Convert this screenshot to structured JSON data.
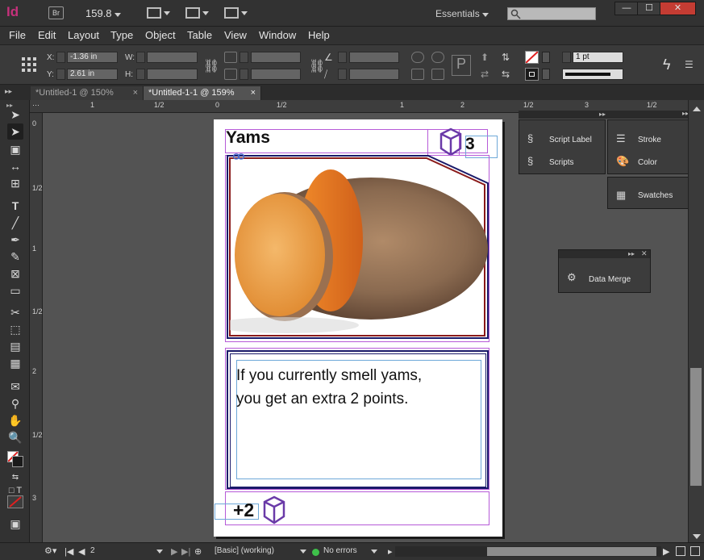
{
  "app": {
    "logo": "Id",
    "bridge_label": "Br",
    "zoom": "159.8",
    "workspace": "Essentials"
  },
  "window_controls": {
    "minimize": "—",
    "restore": "☐",
    "close": "✕"
  },
  "menu": [
    "File",
    "Edit",
    "Layout",
    "Type",
    "Object",
    "Table",
    "View",
    "Window",
    "Help"
  ],
  "control": {
    "x_label": "X:",
    "x_value": "-1.36 in",
    "y_label": "Y:",
    "y_value": "2.61 in",
    "w_label": "W:",
    "h_label": "H:",
    "stroke_weight": "1 pt"
  },
  "tabs": [
    {
      "label": "*Untitled-1 @ 150%",
      "close": "×"
    },
    {
      "label": "*Untitled-1-1 @ 159%",
      "close": "×"
    }
  ],
  "ruler": {
    "h_marks": [
      "1/2",
      "0",
      "1/2",
      "1",
      "1/2",
      "2",
      "1/2",
      "3",
      "1/2"
    ],
    "h_ones": [
      "1"
    ],
    "v_marks": [
      "0",
      "1/2",
      "1",
      "1/2",
      "2",
      "1/2",
      "3"
    ]
  },
  "card": {
    "title": "Yams",
    "cost": "3",
    "description_line1": "If you currently smell yams,",
    "description_line2": "you get an extra 2 points.",
    "points": "+2"
  },
  "panels": {
    "script_label": "Script Label",
    "scripts": "Scripts",
    "stroke": "Stroke",
    "color": "Color",
    "swatches": "Swatches",
    "data_merge": "Data Merge"
  },
  "status": {
    "page": "2",
    "style": "[Basic] (working)",
    "errors": "No errors"
  },
  "colors": {
    "accent_logo": "#c5317b",
    "frame_purple": "#b65ad8",
    "cube_purple": "#6a3aa8",
    "no_errors_green": "#3ec04a"
  }
}
